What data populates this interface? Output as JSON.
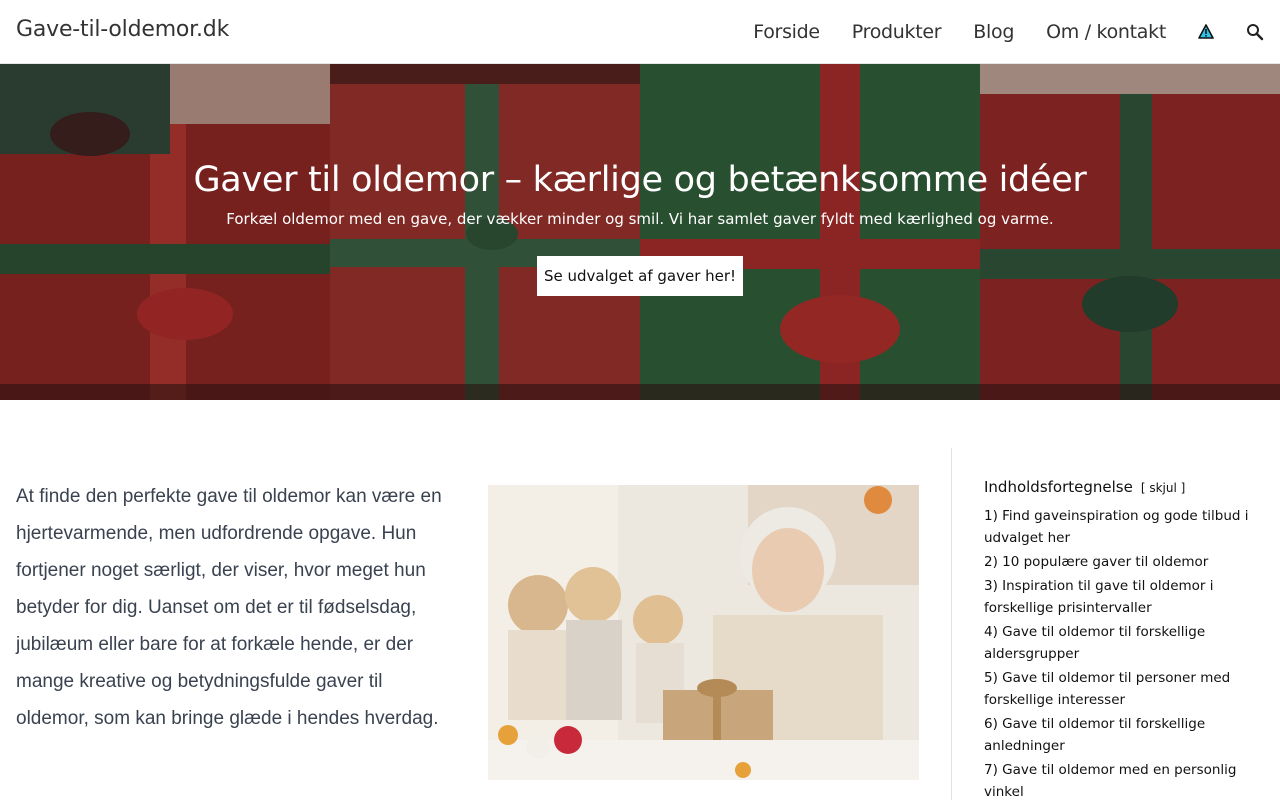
{
  "site": {
    "logo": "Gave-til-oldemor.dk"
  },
  "nav": {
    "items": [
      "Forside",
      "Produkter",
      "Blog",
      "Om / kontakt"
    ],
    "icons": [
      "warning-triangle-icon",
      "search-icon"
    ]
  },
  "hero": {
    "title": "Gaver til oldemor – kærlige og betænksomme idéer",
    "subtitle": "Forkæl oldemor med en gave, der vækker minder og smil. Vi har samlet gaver fyldt med kærlighed og varme.",
    "cta": "Se udvalget af gaver her!"
  },
  "intro": {
    "text": "At finde den perfekte gave til oldemor kan være en hjertevarmende, men udfordrende opgave. Hun fortjener noget særligt, der viser, hvor meget hun betyder for dig. Uanset om det er til fødselsdag, jubilæum eller bare for at forkæle hende, er der mange kreative og betydningsfulde gaver til oldemor, som kan bringe glæde i hendes hverdag."
  },
  "toc": {
    "title": "Indholdsfortegnelse",
    "toggle": "[ skjul ]",
    "items": [
      "1) Find gaveinspiration og gode tilbud i udvalget her",
      "2) 10 populære gaver til oldemor",
      "3) Inspiration til gave til oldemor i forskellige prisintervaller",
      "4) Gave til oldemor til forskellige aldersgrupper",
      "5) Gave til oldemor til personer med forskellige interesser",
      "6) Gave til oldemor til forskellige anledninger",
      "7) Gave til oldemor med en personlig vinkel"
    ]
  },
  "colors": {
    "text": "#333333",
    "intro_text": "#3a4250",
    "gift_red": "#a3282a",
    "gift_green": "#2e6a3d"
  }
}
